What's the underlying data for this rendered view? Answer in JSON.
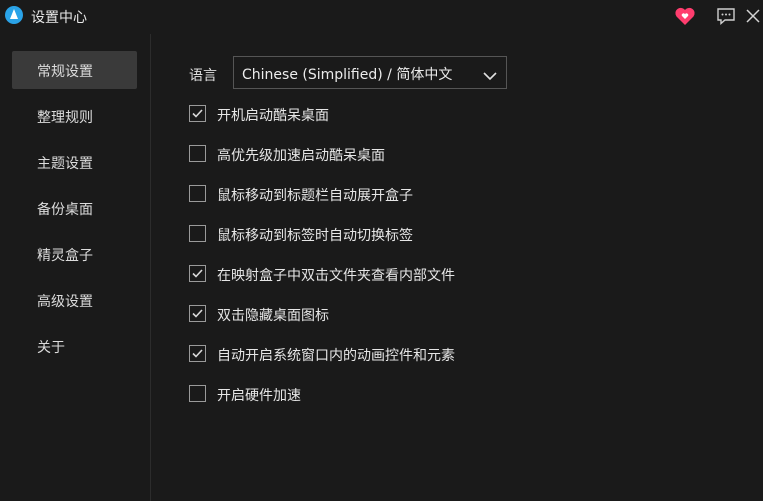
{
  "window": {
    "title": "设置中心",
    "icons": [
      "app-logo-icon",
      "heart-icon",
      "feedback-icon",
      "close-icon"
    ],
    "accent": "#ff3d6e"
  },
  "sidebar": {
    "items": [
      {
        "label": "常规设置",
        "active": true
      },
      {
        "label": "整理规则",
        "active": false
      },
      {
        "label": "主题设置",
        "active": false
      },
      {
        "label": "备份桌面",
        "active": false
      },
      {
        "label": "精灵盒子",
        "active": false
      },
      {
        "label": "高级设置",
        "active": false
      },
      {
        "label": "关于",
        "active": false
      }
    ]
  },
  "general": {
    "language_label": "语言",
    "language_value": "Chinese (Simplified) / 简体中文",
    "options": [
      {
        "label": "开机启动酷呆桌面",
        "checked": true
      },
      {
        "label": "高优先级加速启动酷呆桌面",
        "checked": false
      },
      {
        "label": "鼠标移动到标题栏自动展开盒子",
        "checked": false
      },
      {
        "label": "鼠标移动到标签时自动切换标签",
        "checked": false
      },
      {
        "label": "在映射盒子中双击文件夹查看内部文件",
        "checked": true
      },
      {
        "label": "双击隐藏桌面图标",
        "checked": true
      },
      {
        "label": "自动开启系统窗口内的动画控件和元素",
        "checked": true
      },
      {
        "label": "开启硬件加速",
        "checked": false
      }
    ]
  }
}
